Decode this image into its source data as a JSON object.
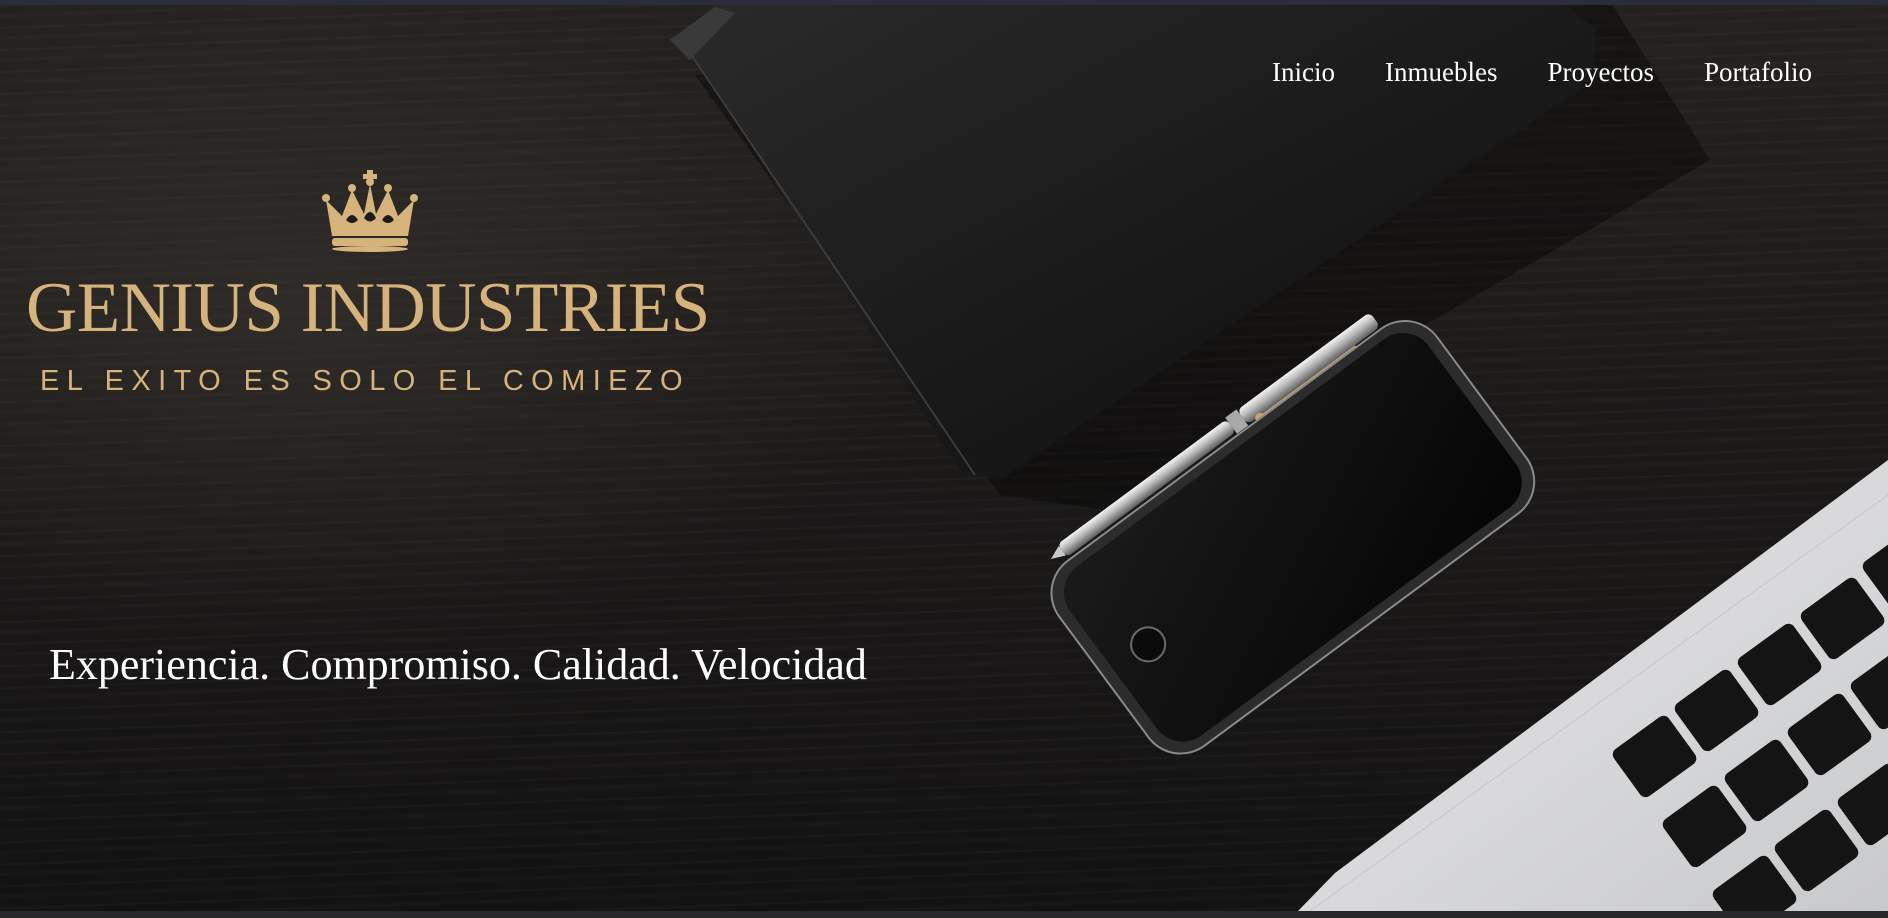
{
  "nav": {
    "items": [
      {
        "label": "Inicio"
      },
      {
        "label": "Inmuebles"
      },
      {
        "label": "Proyectos"
      },
      {
        "label": "Portafolio"
      }
    ]
  },
  "brand": {
    "name": "GENIUS INDUSTRIES",
    "tagline": "EL EXITO ES SOLO EL COMIEZO",
    "logo_icon": "crown-icon",
    "color": "#d6b37a"
  },
  "hero": {
    "slogan": "Experiencia. Compromiso. Calidad. Velocidad"
  }
}
